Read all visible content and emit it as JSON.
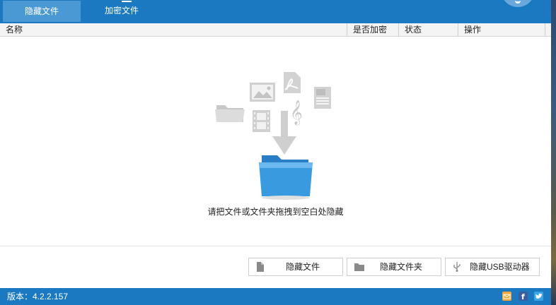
{
  "tabs": [
    {
      "label": "隐藏文件",
      "active": true
    },
    {
      "label": "加密文件",
      "active": false
    }
  ],
  "table": {
    "columns": [
      "名称",
      "是否加密",
      "状态",
      "操作"
    ]
  },
  "drop_hint": "请把文件或文件夹拖拽到空白处隐藏",
  "buttons": {
    "hide_file": "隐藏文件",
    "hide_folder": "隐藏文件夹",
    "hide_usb": "隐藏USB驱动器"
  },
  "footer": {
    "version": "版本：4.2.2.157"
  },
  "colors": {
    "brand_blue": "#1a79c1",
    "active_tab": "#4b99d4",
    "folder_blue": "#3a9ae0"
  }
}
